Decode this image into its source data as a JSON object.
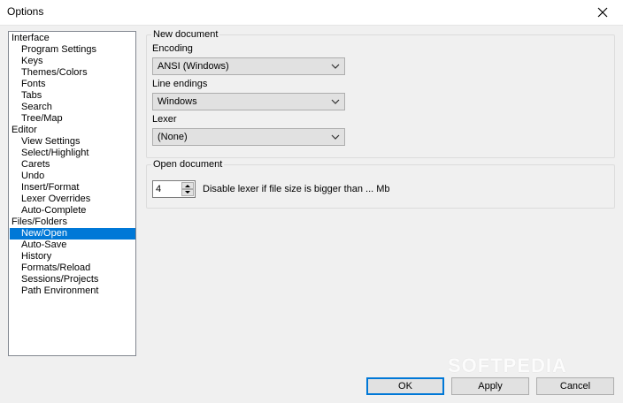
{
  "window": {
    "title": "Options"
  },
  "icons": {
    "close": "close-icon",
    "dropdown": "chevron-down-icon",
    "spin_up": "arrow-up-icon",
    "spin_down": "arrow-down-icon"
  },
  "tree": {
    "items": [
      {
        "label": "Interface",
        "level": 0
      },
      {
        "label": "Program Settings",
        "level": 1
      },
      {
        "label": "Keys",
        "level": 1
      },
      {
        "label": "Themes/Colors",
        "level": 1
      },
      {
        "label": "Fonts",
        "level": 1
      },
      {
        "label": "Tabs",
        "level": 1
      },
      {
        "label": "Search",
        "level": 1
      },
      {
        "label": "Tree/Map",
        "level": 1
      },
      {
        "label": "Editor",
        "level": 0
      },
      {
        "label": "View Settings",
        "level": 1
      },
      {
        "label": "Select/Highlight",
        "level": 1
      },
      {
        "label": "Carets",
        "level": 1
      },
      {
        "label": "Undo",
        "level": 1
      },
      {
        "label": "Insert/Format",
        "level": 1
      },
      {
        "label": "Lexer Overrides",
        "level": 1
      },
      {
        "label": "Auto-Complete",
        "level": 1
      },
      {
        "label": "Files/Folders",
        "level": 0
      },
      {
        "label": "New/Open",
        "level": 1,
        "selected": true
      },
      {
        "label": "Auto-Save",
        "level": 1
      },
      {
        "label": "History",
        "level": 1
      },
      {
        "label": "Formats/Reload",
        "level": 1
      },
      {
        "label": "Sessions/Projects",
        "level": 1
      },
      {
        "label": "Path Environment",
        "level": 1
      }
    ]
  },
  "new_document": {
    "legend": "New document",
    "encoding_label": "Encoding",
    "encoding_value": "ANSI (Windows)",
    "line_endings_label": "Line endings",
    "line_endings_value": "Windows",
    "lexer_label": "Lexer",
    "lexer_value": "(None)"
  },
  "open_document": {
    "legend": "Open document",
    "size_value": "4",
    "size_label": "Disable lexer if file size is bigger than ... Mb"
  },
  "buttons": {
    "ok": "OK",
    "apply": "Apply",
    "cancel": "Cancel"
  },
  "watermark": "SOFTPEDIA",
  "colors": {
    "selection": "#0078d7",
    "default_button_border": "#0078d7"
  }
}
